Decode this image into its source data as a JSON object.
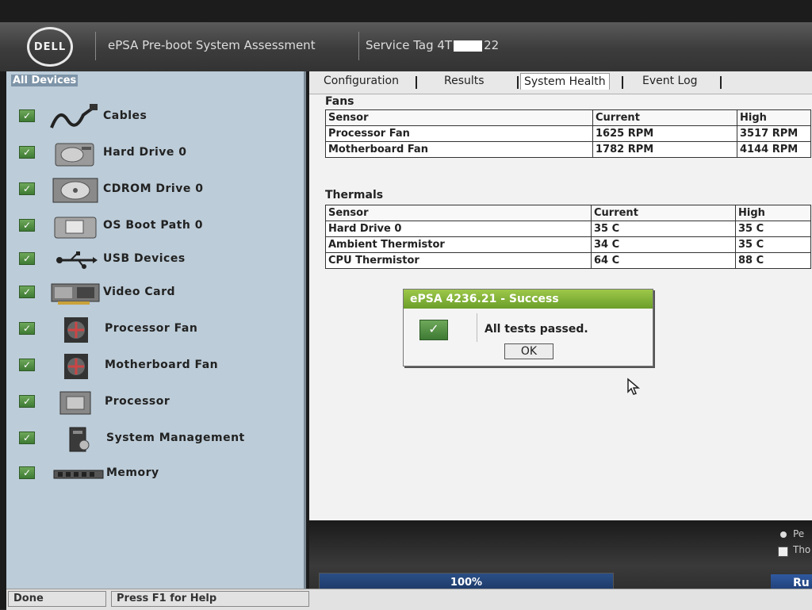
{
  "header": {
    "logo": "DELL",
    "title": "ePSA Pre-boot System Assessment",
    "service_tag_label": "Service Tag",
    "service_tag_prefix": "4T",
    "service_tag_suffix": "22"
  },
  "device_panel": {
    "heading": "All Devices",
    "items": [
      {
        "label": "Cables",
        "icon": "cable-icon",
        "status": "passed"
      },
      {
        "label": "Hard Drive 0",
        "icon": "hard-drive-icon",
        "status": "passed"
      },
      {
        "label": "CDROM Drive 0",
        "icon": "cdrom-icon",
        "status": "passed"
      },
      {
        "label": "OS Boot Path 0",
        "icon": "boot-path-icon",
        "status": "passed"
      },
      {
        "label": "USB Devices",
        "icon": "usb-icon",
        "status": "passed"
      },
      {
        "label": "Video Card",
        "icon": "video-card-icon",
        "status": "passed"
      },
      {
        "label": "Processor Fan",
        "icon": "fan-icon",
        "status": "passed"
      },
      {
        "label": "Motherboard Fan",
        "icon": "fan-icon",
        "status": "passed"
      },
      {
        "label": "Processor",
        "icon": "processor-icon",
        "status": "passed"
      },
      {
        "label": "System Management",
        "icon": "system-management-icon",
        "status": "passed"
      },
      {
        "label": "Memory",
        "icon": "memory-icon",
        "status": "passed"
      }
    ]
  },
  "tabs": [
    {
      "label": "Configuration"
    },
    {
      "label": "Results"
    },
    {
      "label": "System Health",
      "active": true
    },
    {
      "label": "Event Log"
    }
  ],
  "fans": {
    "title": "Fans",
    "columns": [
      "Sensor",
      "Current",
      "High"
    ],
    "rows": [
      [
        "Processor Fan",
        "1625 RPM",
        "3517 RPM"
      ],
      [
        "Motherboard Fan",
        "1782 RPM",
        "4144 RPM"
      ]
    ]
  },
  "thermals": {
    "title": "Thermals",
    "columns": [
      "Sensor",
      "Current",
      "High"
    ],
    "rows": [
      [
        "Hard Drive 0",
        "35 C",
        "35 C"
      ],
      [
        "Ambient Thermistor",
        "34 C",
        "35 C"
      ],
      [
        "CPU Thermistor",
        "64 C",
        "88 C"
      ]
    ]
  },
  "dialog": {
    "title": "ePSA 4236.21 - Success",
    "message": "All tests passed.",
    "ok_label": "OK"
  },
  "progress": {
    "value": 1.0,
    "label": "100%"
  },
  "options": {
    "radio_label": "Pe",
    "check_label": "Tho"
  },
  "run_button": {
    "label": "Ru"
  },
  "status_bar": {
    "left": "Done",
    "help": "Press F1 for Help"
  },
  "colors": {
    "check_green": "#4a8a3c",
    "dialog_title_green": "#86b63c",
    "panel_blue": "#bcccd8",
    "progress_blue": "#2a4f86"
  }
}
